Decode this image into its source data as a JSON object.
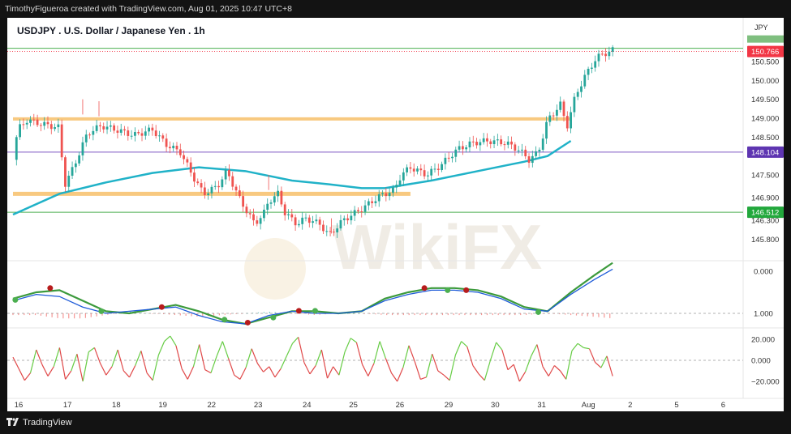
{
  "header": {
    "attribution": "TimothyFigueroa created with TradingView.com, Aug 01, 2025 10:47 UTC+8"
  },
  "footer": {
    "brand": "TradingView"
  },
  "watermark": "WikiFX",
  "colors": {
    "up": "#26a69a",
    "down": "#ef5350",
    "ma": "#20b2c8",
    "support": "#f7c06a",
    "green_line": "#4caf50",
    "purple_line": "#7e57c2",
    "price_tag": "#f23645",
    "macd": "#1e5bd8",
    "signal_up": "#4caf50",
    "signal_down": "#b71c1c",
    "osc_up": "#66cc44",
    "osc_down": "#e04848"
  },
  "chart_data": [
    {
      "type": "candlestick",
      "title": "USDJPY . U.S. Dollar / Japanese Yen . 1h",
      "currency_label": "JPY",
      "ylim": [
        145.4,
        151.4
      ],
      "y_ticks": [
        "145.800",
        "146.300",
        "146.900",
        "147.500",
        "148.500",
        "149.000",
        "149.500",
        "150.000",
        "150.500"
      ],
      "x_ticks": [
        "16",
        "17",
        "18",
        "19",
        "22",
        "23",
        "24",
        "25",
        "26",
        "29",
        "30",
        "31",
        "Aug",
        "2",
        "5",
        "6"
      ],
      "price_tags": [
        {
          "label": "150.766",
          "value": 150.766,
          "color": "#f23645"
        },
        {
          "label": "148.104",
          "value": 148.104,
          "color": "#5e35b1"
        },
        {
          "label": "146.512",
          "value": 146.512,
          "color": "#22a83c"
        }
      ],
      "horizontal_lines": [
        {
          "name": "resistance-high",
          "value": 150.85,
          "color": "#4caf50"
        },
        {
          "name": "resistance-zone",
          "value": 148.98,
          "color": "#f7c06a",
          "from_session": 0,
          "to_session": 12.0
        },
        {
          "name": "pivot",
          "value": 148.104,
          "color": "#7e57c2"
        },
        {
          "name": "support-zone",
          "value": 147.0,
          "color": "#f7c06a",
          "from_session": 0,
          "to_session": 8.55
        },
        {
          "name": "support-low",
          "value": 146.512,
          "color": "#4caf50"
        }
      ],
      "moving_average": [
        [
          0,
          146.45
        ],
        [
          1,
          147.0
        ],
        [
          2,
          147.3
        ],
        [
          3,
          147.55
        ],
        [
          4,
          147.7
        ],
        [
          5,
          147.6
        ],
        [
          6,
          147.35
        ],
        [
          6.8,
          147.25
        ],
        [
          7.5,
          147.15
        ],
        [
          8,
          147.15
        ],
        [
          9,
          147.35
        ],
        [
          10,
          147.6
        ],
        [
          11,
          147.85
        ],
        [
          11.5,
          148.0
        ],
        [
          12,
          148.4
        ]
      ],
      "price_path": [
        [
          0,
          147.9
        ],
        [
          0.1,
          148.7
        ],
        [
          0.3,
          148.95
        ],
        [
          0.6,
          148.85
        ],
        [
          1.0,
          148.75
        ],
        [
          1.1,
          147.2
        ],
        [
          1.3,
          147.7
        ],
        [
          1.6,
          148.6
        ],
        [
          1.9,
          148.8
        ],
        [
          2.2,
          148.7
        ],
        [
          2.6,
          148.55
        ],
        [
          3.0,
          148.7
        ],
        [
          3.3,
          148.3
        ],
        [
          3.6,
          148.1
        ],
        [
          3.9,
          147.4
        ],
        [
          4.1,
          147.0
        ],
        [
          4.4,
          147.2
        ],
        [
          4.6,
          147.6
        ],
        [
          4.9,
          146.8
        ],
        [
          5.2,
          146.2
        ],
        [
          5.4,
          146.5
        ],
        [
          5.5,
          146.8
        ],
        [
          5.7,
          147.0
        ],
        [
          5.85,
          146.5
        ],
        [
          6.1,
          146.2
        ],
        [
          6.3,
          146.35
        ],
        [
          6.6,
          146.2
        ],
        [
          6.8,
          145.9
        ],
        [
          7.1,
          146.3
        ],
        [
          7.5,
          146.6
        ],
        [
          7.9,
          146.95
        ],
        [
          8.2,
          147.1
        ],
        [
          8.35,
          147.5
        ],
        [
          8.55,
          147.7
        ],
        [
          8.9,
          147.5
        ],
        [
          9.2,
          147.75
        ],
        [
          9.4,
          148.0
        ],
        [
          9.6,
          148.2
        ],
        [
          9.9,
          148.35
        ],
        [
          10.2,
          148.4
        ],
        [
          10.6,
          148.35
        ],
        [
          10.9,
          148.15
        ],
        [
          11.1,
          147.9
        ],
        [
          11.3,
          148.1
        ],
        [
          11.5,
          148.95
        ],
        [
          11.8,
          149.4
        ],
        [
          11.9,
          148.7
        ],
        [
          12.1,
          149.6
        ],
        [
          12.3,
          150.1
        ],
        [
          12.55,
          150.6
        ],
        [
          12.7,
          150.7
        ],
        [
          12.9,
          150.8
        ]
      ],
      "highs": [
        [
          1.5,
          149.1
        ],
        [
          1.85,
          149.05
        ],
        [
          5.5,
          147.1
        ],
        [
          6.85,
          145.95
        ]
      ]
    },
    {
      "type": "line",
      "name": "momentum-oscillator",
      "ylim": [
        -0.25,
        1.25
      ],
      "y_ticks": [
        "0.000",
        "1.000"
      ],
      "series_macd": [
        [
          0,
          0.3
        ],
        [
          0.5,
          0.45
        ],
        [
          1.0,
          0.4
        ],
        [
          1.5,
          0.15
        ],
        [
          2.0,
          0.0
        ],
        [
          2.5,
          0.05
        ],
        [
          3.0,
          0.1
        ],
        [
          3.5,
          0.15
        ],
        [
          4.0,
          -0.05
        ],
        [
          4.5,
          -0.2
        ],
        [
          5.0,
          -0.25
        ],
        [
          5.5,
          -0.05
        ],
        [
          6.0,
          0.05
        ],
        [
          6.5,
          0.0
        ],
        [
          7.0,
          0.0
        ],
        [
          7.5,
          0.05
        ],
        [
          8.0,
          0.3
        ],
        [
          8.5,
          0.45
        ],
        [
          9.0,
          0.55
        ],
        [
          9.5,
          0.55
        ],
        [
          10.0,
          0.5
        ],
        [
          10.5,
          0.35
        ],
        [
          11.0,
          0.1
        ],
        [
          11.5,
          0.05
        ],
        [
          12.0,
          0.45
        ],
        [
          12.5,
          0.8
        ],
        [
          12.9,
          1.05
        ]
      ],
      "series_signal": [
        [
          0,
          0.35
        ],
        [
          0.5,
          0.5
        ],
        [
          1.0,
          0.55
        ],
        [
          1.5,
          0.3
        ],
        [
          2.0,
          0.05
        ],
        [
          2.5,
          0.0
        ],
        [
          3.0,
          0.1
        ],
        [
          3.5,
          0.2
        ],
        [
          4.0,
          0.05
        ],
        [
          4.5,
          -0.15
        ],
        [
          5.0,
          -0.25
        ],
        [
          5.5,
          -0.1
        ],
        [
          6.0,
          0.05
        ],
        [
          6.5,
          0.05
        ],
        [
          7.0,
          0.0
        ],
        [
          7.5,
          0.05
        ],
        [
          8.0,
          0.35
        ],
        [
          8.5,
          0.5
        ],
        [
          9.0,
          0.6
        ],
        [
          9.5,
          0.6
        ],
        [
          10.0,
          0.55
        ],
        [
          10.5,
          0.4
        ],
        [
          11.0,
          0.15
        ],
        [
          11.5,
          0.05
        ],
        [
          12.0,
          0.5
        ],
        [
          12.5,
          0.9
        ],
        [
          12.9,
          1.2
        ]
      ],
      "cross_dots": [
        {
          "x": 0.05,
          "y": 0.32,
          "kind": "up"
        },
        {
          "x": 0.8,
          "y": 0.6,
          "kind": "down"
        },
        {
          "x": 1.9,
          "y": 0.05,
          "kind": "up"
        },
        {
          "x": 3.2,
          "y": 0.15,
          "kind": "down"
        },
        {
          "x": 4.55,
          "y": -0.15,
          "kind": "up"
        },
        {
          "x": 5.05,
          "y": -0.22,
          "kind": "down"
        },
        {
          "x": 5.6,
          "y": -0.1,
          "kind": "up"
        },
        {
          "x": 6.15,
          "y": 0.06,
          "kind": "down"
        },
        {
          "x": 6.5,
          "y": 0.06,
          "kind": "up"
        },
        {
          "x": 8.85,
          "y": 0.6,
          "kind": "down"
        },
        {
          "x": 9.35,
          "y": 0.55,
          "kind": "up"
        },
        {
          "x": 9.75,
          "y": 0.55,
          "kind": "down"
        },
        {
          "x": 11.3,
          "y": 0.03,
          "kind": "up"
        }
      ]
    },
    {
      "type": "line",
      "name": "rsi-style-oscillator",
      "ylim": [
        -30,
        30
      ],
      "y_ticks": [
        "20.000",
        "0.000",
        "−20.000"
      ],
      "values": [
        3,
        -8,
        -19,
        -12,
        10,
        -4,
        -15,
        -6,
        12,
        -18,
        -10,
        6,
        -20,
        8,
        12,
        -3,
        -14,
        -6,
        10,
        -10,
        -16,
        -5,
        9,
        -12,
        -19,
        5,
        18,
        23,
        14,
        -8,
        -18,
        -6,
        15,
        -9,
        -12,
        4,
        18,
        2,
        -14,
        -18,
        -7,
        11,
        -3,
        -11,
        -6,
        -16,
        -8,
        4,
        16,
        22,
        -2,
        -13,
        -5,
        10,
        -17,
        -6,
        -14,
        8,
        21,
        17,
        -4,
        -15,
        -3,
        18,
        2,
        -12,
        -20,
        -7,
        14,
        -1,
        -18,
        -16,
        6,
        -10,
        -14,
        -19,
        5,
        18,
        13,
        -5,
        -13,
        -19,
        0,
        17,
        10,
        -9,
        -4,
        -20,
        -11,
        4,
        15,
        -6,
        -15,
        -5,
        -10,
        -18,
        9,
        16,
        12,
        11,
        -2,
        -7,
        4,
        -15
      ]
    }
  ]
}
